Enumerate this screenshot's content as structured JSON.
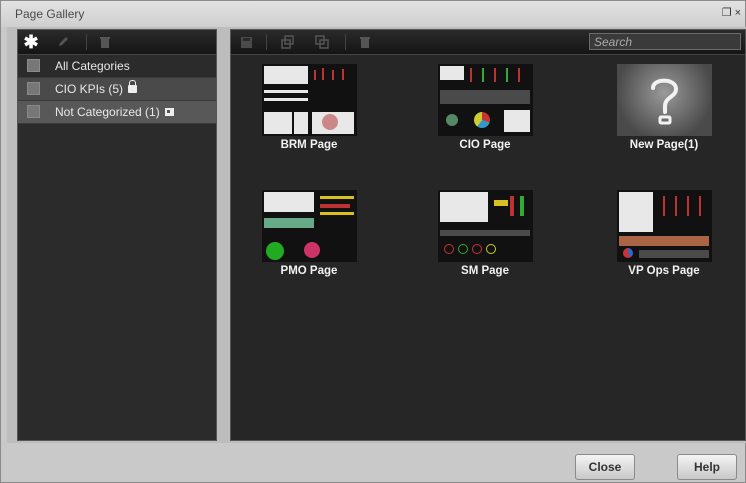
{
  "window": {
    "title": "Page Gallery",
    "restore_glyph": "❐",
    "close_glyph": "×"
  },
  "left_toolbar": {
    "icons": [
      "new-category-icon",
      "edit-category-icon",
      "delete-category-icon"
    ]
  },
  "categories": [
    {
      "label": "All Categories",
      "icon": null
    },
    {
      "label": "CIO KPIs (5)",
      "icon": "lock-icon"
    },
    {
      "label": "Not Categorized (1)",
      "icon": "uncategorized-icon"
    }
  ],
  "right_toolbar": {
    "icons": [
      "save-icon",
      "duplicate-icon",
      "copy-icon",
      "delete-page-icon"
    ],
    "search_placeholder": "Search"
  },
  "pages": [
    {
      "label": "BRM Page"
    },
    {
      "label": "CIO Page"
    },
    {
      "label": "New Page(1)"
    },
    {
      "label": "PMO Page"
    },
    {
      "label": "SM Page"
    },
    {
      "label": "VP Ops Page"
    }
  ],
  "footer": {
    "close_label": "Close",
    "help_label": "Help"
  }
}
